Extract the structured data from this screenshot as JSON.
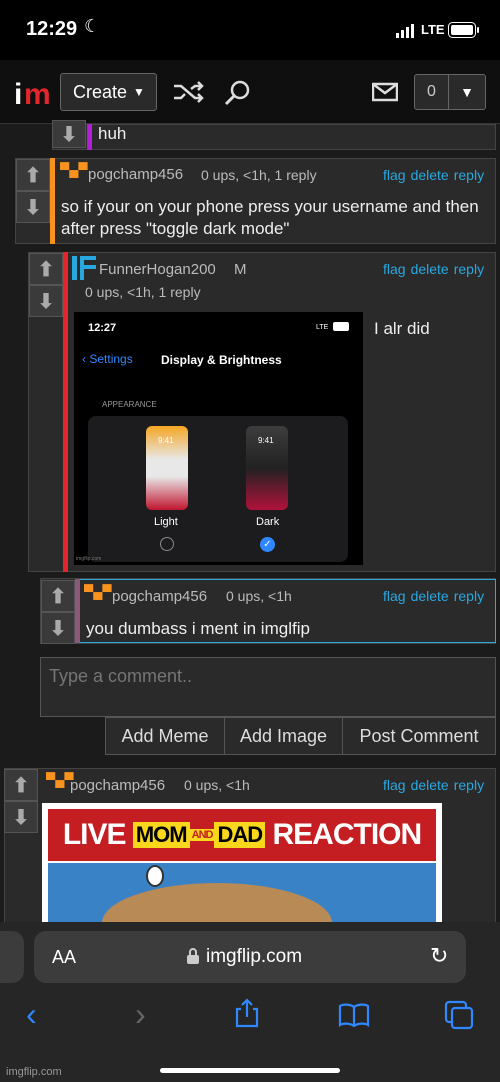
{
  "status_bar": {
    "time": "12:29",
    "network": "LTE"
  },
  "nav": {
    "create_label": "Create",
    "notif_count": "0"
  },
  "thread": {
    "top_snippet": "huh",
    "comments": [
      {
        "username": "pogchamp456",
        "meta": "0 ups, <1h, 1 reply",
        "links": [
          "flag",
          "delete",
          "reply"
        ],
        "text": "so if your on your phone press your username and then after press \"toggle dark mode\""
      },
      {
        "username": "FunnerHogan200",
        "badge": "M",
        "meta": "0 ups, <1h, 1 reply",
        "links": [
          "flag",
          "delete",
          "reply"
        ],
        "side_text": "I alr did",
        "screenshot": {
          "time": "12:27",
          "network": "LTE",
          "back_label": "Settings",
          "title": "Display & Brightness",
          "section": "APPEARANCE",
          "tile_time": "9:41",
          "light_label": "Light",
          "dark_label": "Dark",
          "watermark": "imgflip.com"
        }
      },
      {
        "username": "pogchamp456",
        "meta": "0 ups, <1h",
        "links": [
          "flag",
          "delete",
          "reply"
        ],
        "text": "you dumbass i ment in imglfip"
      }
    ],
    "reply_box": {
      "placeholder": "Type a comment..",
      "add_meme": "Add Meme",
      "add_image": "Add Image",
      "post_comment": "Post Comment"
    },
    "last_comment": {
      "username": "pogchamp456",
      "meta": "0 ups, <1h",
      "links": [
        "flag",
        "delete",
        "reply"
      ],
      "meme_caption": "LIVE MOM AND DAD REACTION",
      "meme_parts": [
        "LIVE",
        "MOM",
        "AND",
        "DAD",
        "REACTION"
      ]
    }
  },
  "safari": {
    "font_control": "AA",
    "url": "imgflip.com"
  },
  "footer_watermark": "imgflip.com",
  "colors": {
    "accent_blue": "#29a8e0",
    "orange": "#f7931e",
    "red": "#e2262b",
    "purple": "#b21fd6"
  }
}
